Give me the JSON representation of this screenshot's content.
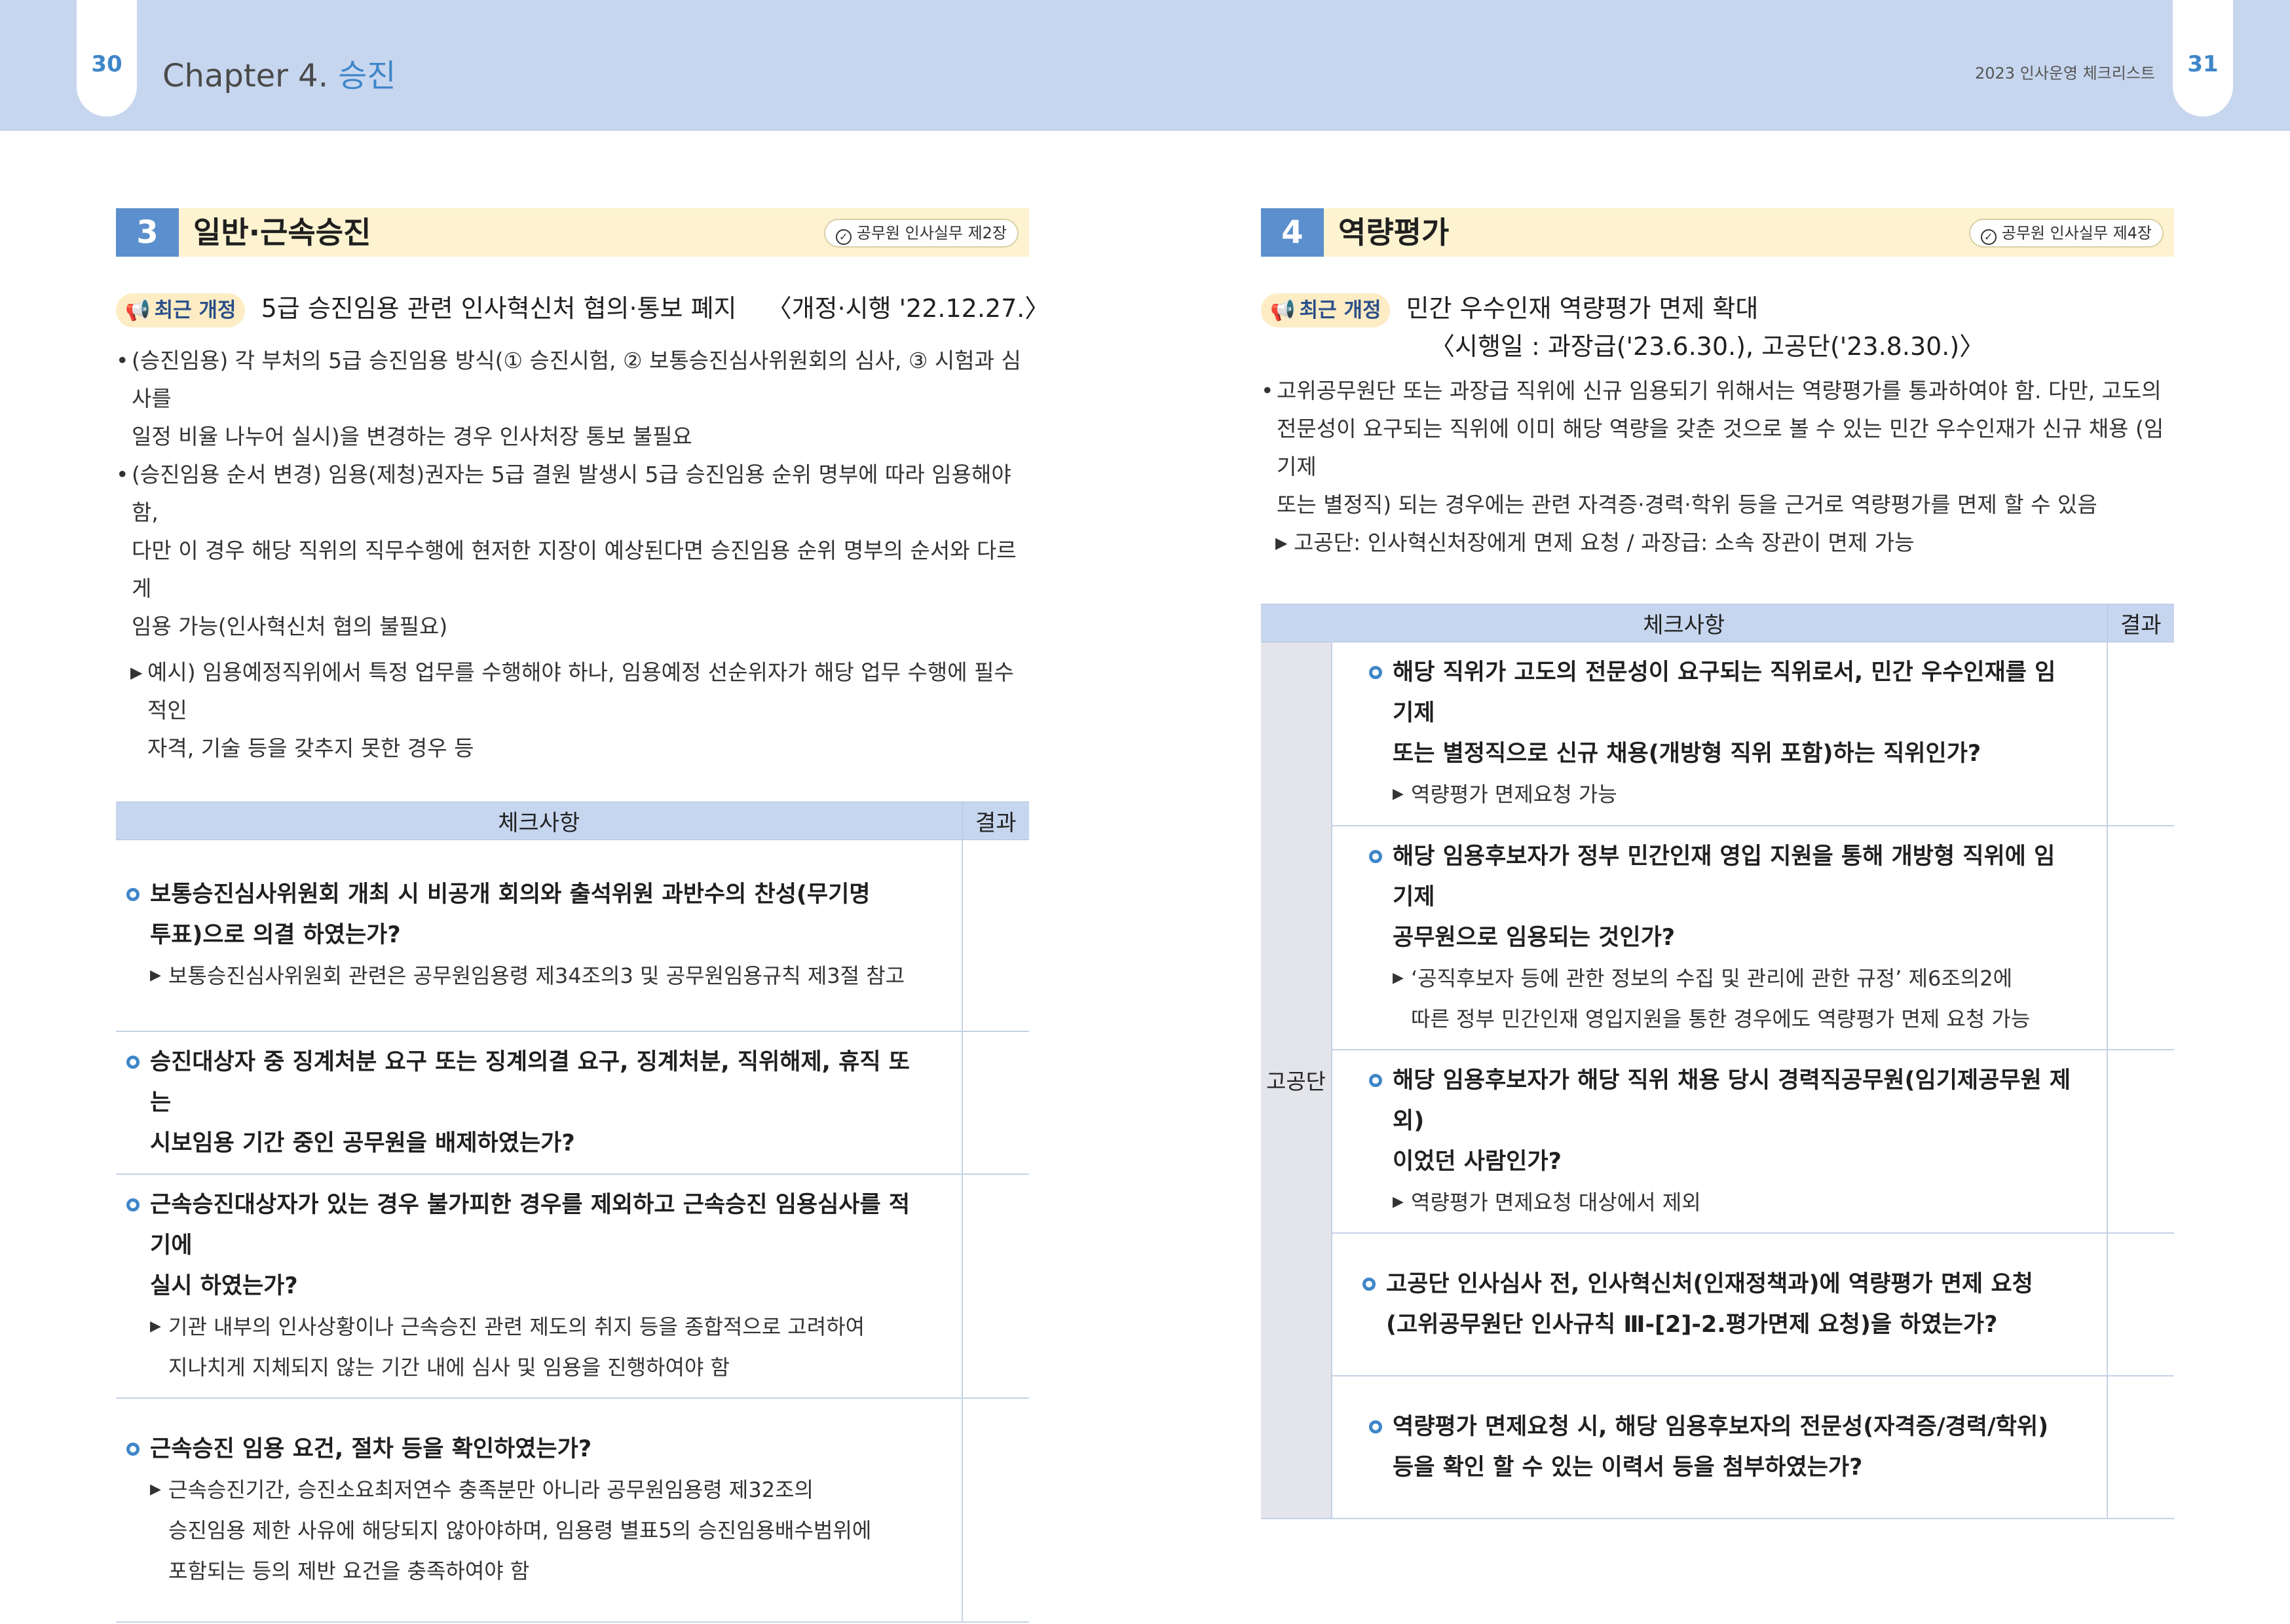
{
  "header": {
    "left_page": "30",
    "right_page": "31",
    "chapter_prefix": "Chapter 4. ",
    "chapter_accent": "승진",
    "doc_title": "2023 인사운영 체크리스트"
  },
  "left": {
    "section_num": "3",
    "section_title": "일반·근속승진",
    "section_ref": "공무원 인사실무 제2장",
    "badge": "최근 개정",
    "revision": "5급 승진임용 관련 인사혁신처 협의·통보 폐지",
    "revision_date": "〈개정·시행 '22.12.27.〉",
    "bullets": [
      {
        "l1": "(승진임용) 각 부처의 5급 승진임용 방식(① 승진시험, ② 보통승진심사위원회의 심사, ③ 시험과 심사를",
        "l2": "일정 비율 나누어 실시)을 변경하는 경우 인사처장 통보 불필요",
        "l3": ""
      },
      {
        "l1": "(승진임용 순서 변경) 임용(제청)권자는 5급 결원 발생시 5급 승진임용 순위 명부에 따라 임용해야 함,",
        "l2": "다만 이 경우 해당 직위의 직무수행에 현저한 지장이 예상된다면 승진임용 순위 명부의 순서와 다르게",
        "l3": "임용 가능(인사혁신처 협의 불필요)"
      }
    ],
    "example_l1": "예시) 임용예정직위에서 특정 업무를 수행해야 하나, 임용예정 선순위자가 해당 업무 수행에 필수적인",
    "example_l2": "자격, 기술 등을 갖추지 못한 경우 등",
    "table_header": "체크사항",
    "result_header": "결과",
    "items": [
      {
        "q1": "보통승진심사위원회 개최 시 비공개 회의와 출석위원 과반수의 찬성(무기명",
        "q2": "투표)으로 의결 하였는가?",
        "n1": "보통승진심사위원회 관련은 공무원임용령 제34조의3 및 공무원임용규칙 제3절 참고",
        "n2": "",
        "n3": ""
      },
      {
        "q1": "승진대상자 중 징계처분 요구 또는 징계의결 요구, 징계처분, 직위해제, 휴직 또는",
        "q2": "시보임용 기간 중인 공무원을 배제하였는가?",
        "n1": "",
        "n2": "",
        "n3": ""
      },
      {
        "q1": "근속승진대상자가 있는 경우 불가피한 경우를 제외하고 근속승진 임용심사를 적기에",
        "q2": "실시 하였는가?",
        "n1": "기관 내부의 인사상황이나 근속승진 관련 제도의 취지 등을 종합적으로 고려하여",
        "n2": "지나치게 지체되지 않는 기간 내에 심사 및 임용을 진행하여야 함",
        "n3": ""
      },
      {
        "q1": "근속승진 임용 요건, 절차 등을 확인하였는가?",
        "q2": "",
        "n1": "근속승진기간, 승진소요최저연수 충족분만 아니라 공무원임용령 제32조의",
        "n2": "승진임용 제한 사유에 해당되지 않아야하며, 임용령 별표5의 승진임용배수범위에",
        "n3": "포함되는 등의 제반 요건을 충족하여야 함"
      }
    ]
  },
  "right": {
    "section_num": "4",
    "section_title": "역량평가",
    "section_ref": "공무원 인사실무 제4장",
    "badge": "최근 개정",
    "revision": "민간 우수인재 역량평가 면제 확대",
    "revision_date": "〈시행일 : 과장급('23.6.30.), 고공단('23.8.30.)〉",
    "bullet_l1": "고위공무원단 또는 과장급 직위에 신규 임용되기 위해서는 역량평가를 통과하여야 함. 다만, 고도의",
    "bullet_l2": "전문성이 요구되는 직위에 이미 해당 역량을 갖춘 것으로 볼 수 있는 민간 우수인재가 신규 채용 (임기제",
    "bullet_l3": "또는 별정직) 되는 경우에는 관련 자격증·경력·학위 등을 근거로 역량평가를 면제 할 수 있음",
    "note": "고공단: 인사혁신처장에게 면제 요청 / 과장급: 소속 장관이 면제 가능",
    "table_header": "체크사항",
    "result_header": "결과",
    "group": "고공단",
    "items": [
      {
        "q1": "해당 직위가 고도의 전문성이 요구되는 직위로서, 민간 우수인재를 임기제",
        "q2": "또는 별정직으로 신규 채용(개방형 직위 포함)하는 직위인가?",
        "n1": "역량평가 면제요청 가능",
        "n2": ""
      },
      {
        "q1": "해당 임용후보자가 정부 민간인재 영입 지원을 통해 개방형 직위에 임기제",
        "q2": "공무원으로 임용되는 것인가?",
        "n1": "‘공직후보자 등에 관한 정보의 수집 및 관리에 관한 규정’ 제6조의2에",
        "n2": "따른 정부 민간인재 영입지원을 통한 경우에도 역량평가 면제 요청 가능"
      },
      {
        "q1": "해당 임용후보자가 해당 직위 채용 당시 경력직공무원(임기제공무원 제외)",
        "q2": "이었던 사람인가?",
        "n1": "역량평가 면제요청 대상에서 제외",
        "n2": ""
      },
      {
        "q1": "고공단 인사심사 전, 인사혁신처(인재정책과)에 역량평가 면제 요청",
        "q2": "(고위공무원단 인사규칙 Ⅲ-[2]-2.평가면제 요청)을 하였는가?",
        "n1": "",
        "n2": ""
      },
      {
        "q1": "역량평가 면제요청 시, 해당 임용후보자의 전문성(자격증/경력/학위)",
        "q2": "등을 확인 할 수 있는 이력서 등을 첨부하였는가?",
        "n1": "",
        "n2": ""
      }
    ]
  }
}
